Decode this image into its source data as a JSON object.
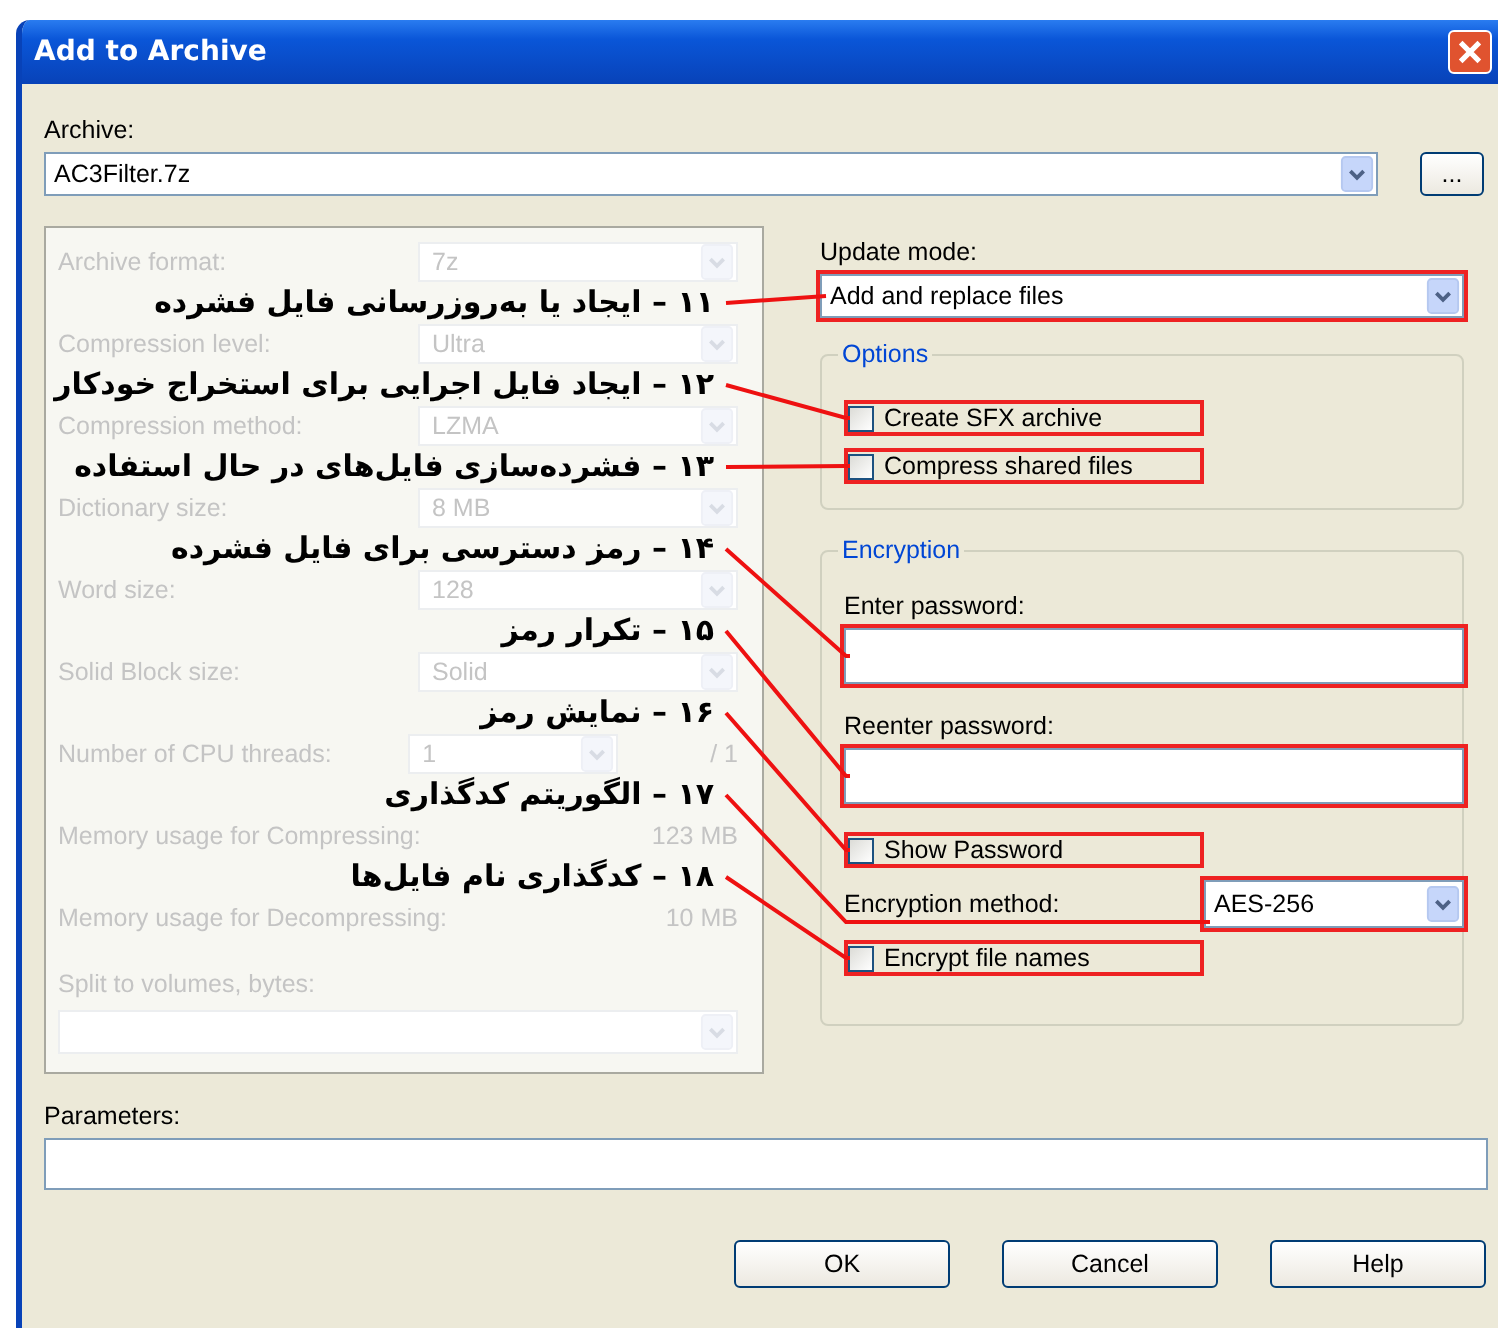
{
  "window": {
    "title": "Add to Archive"
  },
  "archive": {
    "label": "Archive:",
    "value": "AC3Filter.7z",
    "browse": "..."
  },
  "settings": {
    "disabled": true,
    "rows": [
      {
        "kind": "combo",
        "label": "Archive format:",
        "value": "7z"
      },
      {
        "kind": "combo",
        "label": "Compression level:",
        "value": "Ultra"
      },
      {
        "kind": "combo",
        "label": "Compression method:",
        "value": "LZMA"
      },
      {
        "kind": "combo",
        "label": "Dictionary size:",
        "value": "8 MB"
      },
      {
        "kind": "combo",
        "label": "Word size:",
        "value": "128"
      },
      {
        "kind": "combo",
        "label": "Solid Block size:",
        "value": "Solid"
      },
      {
        "kind": "threads",
        "label": "Number of CPU threads:",
        "value": "1",
        "total": "/ 1"
      },
      {
        "kind": "info",
        "label": "Memory usage for Compressing:",
        "value": "123 MB"
      },
      {
        "kind": "info",
        "label": "Memory usage for Decompressing:",
        "value": "10 MB"
      },
      {
        "kind": "split",
        "label": "Split to volumes, bytes:"
      }
    ]
  },
  "annotations": [
    "۱۱ – ایجاد یا به‌روزرسانی فایل فشرده",
    "۱۲ – ایجاد فایل اجرایی برای استخراج خودکار",
    "۱۳ – فشرده‌سازی فایل‌های در حال استفاده",
    "۱۴ – رمز دسترسی برای فایل فشرده",
    "۱۵ – تکرار رمز",
    "۱۶ – نمایش رمز",
    "۱۷ – الگوریتم کدگذاری",
    "۱۸ – کدگذاری نام فایل‌ها"
  ],
  "update_mode": {
    "label": "Update mode:",
    "value": "Add and replace files",
    "highlighted": true
  },
  "options": {
    "title": "Options",
    "items": [
      {
        "label": "Create SFX archive",
        "checked": false,
        "highlighted": true
      },
      {
        "label": "Compress shared files",
        "checked": false,
        "highlighted": true
      }
    ]
  },
  "encryption": {
    "title": "Encryption",
    "password": {
      "label": "Enter password:",
      "highlighted": true
    },
    "reenter": {
      "label": "Reenter password:",
      "highlighted": true
    },
    "show_password": {
      "label": "Show Password",
      "checked": false,
      "highlighted": true
    },
    "method": {
      "label": "Encryption method:",
      "value": "AES-256",
      "highlighted": true
    },
    "encrypt_names": {
      "label": "Encrypt file names",
      "checked": false,
      "highlighted": true
    }
  },
  "parameters": {
    "label": "Parameters:"
  },
  "buttons": [
    "OK",
    "Cancel",
    "Help"
  ]
}
